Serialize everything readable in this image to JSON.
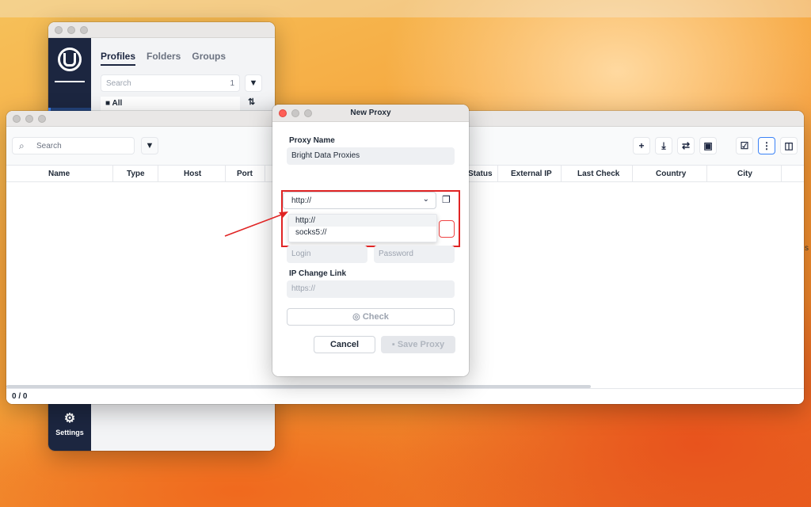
{
  "profiles_window": {
    "tabs": [
      "Profiles",
      "Folders",
      "Groups"
    ],
    "search": {
      "placeholder": "Search",
      "count": "1"
    },
    "folder_all": "All",
    "settings_label": "Settings"
  },
  "proxies_window": {
    "search": {
      "placeholder": "Search"
    },
    "columns": [
      "Name",
      "Type",
      "Host",
      "Port",
      "Status",
      "External IP",
      "Last Check",
      "Country",
      "City"
    ],
    "footer_count": "0 / 0",
    "clipped_text": "s"
  },
  "dialog": {
    "title": "New Proxy",
    "proxy_name_label": "Proxy Name",
    "proxy_name_value": "Bright Data Proxies",
    "protocol": {
      "selected": "http://",
      "options": [
        "http://",
        "socks5://"
      ]
    },
    "login_placeholder": "Login",
    "password_placeholder": "Password",
    "ip_change_label": "IP Change Link",
    "ip_change_placeholder": "https://",
    "check_label": "Check",
    "cancel_label": "Cancel",
    "save_label": "Save Proxy"
  },
  "colors": {
    "sidebar": "#1c2640",
    "highlight_red": "#e02424",
    "accent": "#3b82f6"
  }
}
